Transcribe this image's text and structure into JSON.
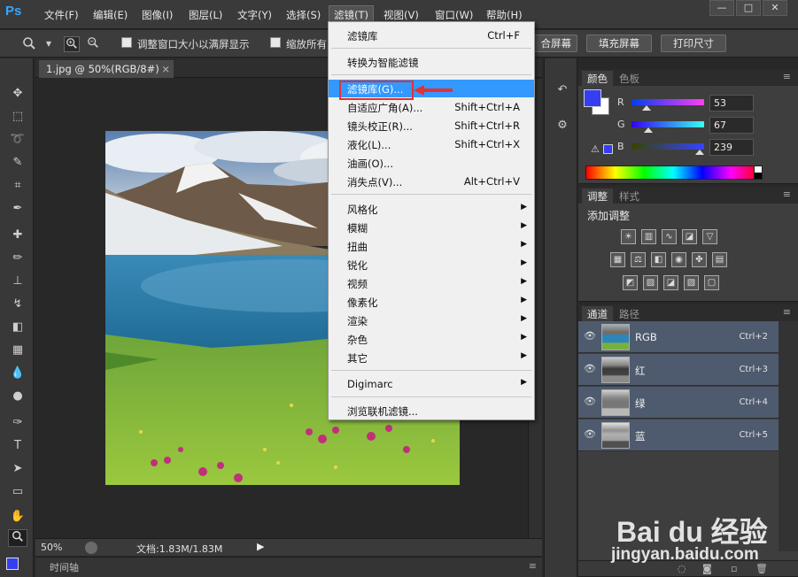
{
  "app": {
    "logo": "Ps"
  },
  "menubar": {
    "items": [
      {
        "label": "文件(F)"
      },
      {
        "label": "编辑(E)"
      },
      {
        "label": "图像(I)"
      },
      {
        "label": "图层(L)"
      },
      {
        "label": "文字(Y)"
      },
      {
        "label": "选择(S)"
      },
      {
        "label": "滤镜(T)"
      },
      {
        "label": "视图(V)"
      },
      {
        "label": "窗口(W)"
      },
      {
        "label": "帮助(H)"
      }
    ],
    "window_buttons": [
      "—",
      "□",
      "✕"
    ]
  },
  "optionsbar": {
    "resize_window_label": "调整窗口大小以满屏显示",
    "zoom_all_label": "缩放所有",
    "fill_screen_partial": "合屏幕",
    "fill_screen_label": "填充屏幕",
    "print_size_label": "打印尺寸"
  },
  "document": {
    "tab_title": "1.jpg @ 50%(RGB/8#)",
    "tab_close": "×",
    "zoom": "50%",
    "doc_info": "文档:1.83M/1.83M",
    "timeline_label": "时间轴"
  },
  "filter_menu": {
    "items": [
      {
        "label": "滤镜库",
        "shortcut": "Ctrl+F"
      },
      {
        "label": "转换为智能滤镜"
      },
      {
        "label": "滤镜库(G)...",
        "highlighted": true
      },
      {
        "label": "自适应广角(A)...",
        "shortcut": "Shift+Ctrl+A"
      },
      {
        "label": "镜头校正(R)...",
        "shortcut": "Shift+Ctrl+R"
      },
      {
        "label": "液化(L)...",
        "shortcut": "Shift+Ctrl+X"
      },
      {
        "label": "油画(O)..."
      },
      {
        "label": "消失点(V)...",
        "shortcut": "Alt+Ctrl+V"
      },
      {
        "label": "风格化",
        "submenu": true
      },
      {
        "label": "模糊",
        "submenu": true
      },
      {
        "label": "扭曲",
        "submenu": true
      },
      {
        "label": "锐化",
        "submenu": true
      },
      {
        "label": "视频",
        "submenu": true
      },
      {
        "label": "像素化",
        "submenu": true
      },
      {
        "label": "渲染",
        "submenu": true
      },
      {
        "label": "杂色",
        "submenu": true
      },
      {
        "label": "其它",
        "submenu": true
      },
      {
        "label": "Digimarc",
        "submenu": true
      },
      {
        "label": "浏览联机滤镜..."
      }
    ],
    "highlight_color": "#3399ff",
    "annotation_color": "#e53030"
  },
  "color_panel": {
    "tabs": [
      "颜色",
      "色板"
    ],
    "foreground": "#353ef0",
    "background": "#ffffff",
    "r": {
      "label": "R",
      "value": "53"
    },
    "g": {
      "label": "G",
      "value": "67"
    },
    "b": {
      "label": "B",
      "value": "239"
    }
  },
  "adjust_panel": {
    "tabs": [
      "调整",
      "样式"
    ],
    "title": "添加调整"
  },
  "channels_panel": {
    "tabs": [
      "通道",
      "路径"
    ],
    "channels": [
      {
        "name": "RGB",
        "shortcut": "Ctrl+2"
      },
      {
        "name": "红",
        "shortcut": "Ctrl+3"
      },
      {
        "name": "绿",
        "shortcut": "Ctrl+4"
      },
      {
        "name": "蓝",
        "shortcut": "Ctrl+5"
      }
    ]
  },
  "watermark": {
    "brand": "Bai du 经验",
    "url": "jingyan.baidu.com"
  }
}
